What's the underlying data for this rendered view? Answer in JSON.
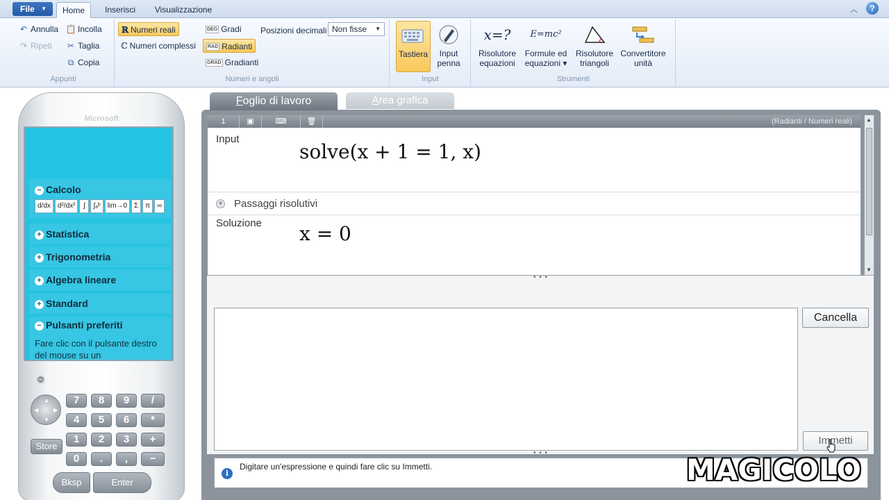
{
  "ribbon": {
    "file_label": "File",
    "tabs": [
      {
        "label": "Home",
        "active": true
      },
      {
        "label": "Inserisci",
        "active": false
      },
      {
        "label": "Visualizzazione",
        "active": false
      }
    ],
    "groups": {
      "appunti": {
        "label": "Appunti",
        "undo": "Annulla",
        "redo": "Ripeti",
        "paste": "Incolla",
        "cut": "Taglia",
        "copy": "Copia"
      },
      "numeri": {
        "label": "Numeri e angoli",
        "real": "Numeri reali",
        "complex": "Numeri complessi",
        "deg_badge": "DEG",
        "deg": "Gradi",
        "rad_badge": "RAD",
        "rad": "Radianti",
        "grad_badge": "GRAD",
        "grad": "Gradianti",
        "decimal_label": "Posizioni decimali",
        "decimal_value": "Non fisse"
      },
      "input": {
        "label": "Input",
        "keyboard_line1": "Tastiera",
        "pen_line1": "Input",
        "pen_line2": "penna"
      },
      "strumenti": {
        "label": "Strumenti",
        "eq_icon": "x=?",
        "eq_line1": "Risolutore",
        "eq_line2": "equazioni",
        "formula_icon": "E=mc²",
        "formula_line1": "Formule ed",
        "formula_line2": "equazioni ▾",
        "tri_line1": "Risolutore",
        "tri_line2": "triangoli",
        "conv_line1": "Convertitore",
        "conv_line2": "unità"
      }
    }
  },
  "calculator": {
    "brand": "Microsoft",
    "sections": {
      "calcolo": "Calcolo",
      "statistica": "Statistica",
      "trigonometria": "Trigonometria",
      "algebra": "Algebra lineare",
      "standard": "Standard",
      "preferiti": "Pulsanti preferiti"
    },
    "favorites_hint": "Fare clic con il pulsante destro del mouse su un",
    "calc_keys": [
      "d/dx",
      "d²/dx²",
      "∫",
      "∫ₐᵇ",
      "lim→0",
      "Σ",
      "π",
      "∞"
    ],
    "keypad": {
      "row1": [
        "7",
        "8",
        "9",
        "/"
      ],
      "row2": [
        "4",
        "5",
        "6",
        "*"
      ],
      "row3": [
        "1",
        "2",
        "3",
        "+"
      ],
      "row4": [
        "0",
        ".",
        ",",
        "−"
      ],
      "store": "Store",
      "bksp": "Bksp",
      "enter": "Enter"
    }
  },
  "worksheet": {
    "tab_main_u": "F",
    "tab_main_rest": "oglio di lavoro",
    "tab_graph_u": "A",
    "tab_graph_rest": "rea grafica",
    "history_index": "1",
    "mode_label": "(Radianti / Numeri reali)",
    "input_label": "Input",
    "input_expr": "solve(x + 1 = 1, x)",
    "steps_label": "Passaggi risolutivi",
    "solution_label": "Soluzione",
    "solution_expr": "x = 0",
    "clear_button": "Cancella",
    "enter_button": "Immetti",
    "input_value": "",
    "status_text": "Digitare un'espressione e quindi fare clic su Immetti."
  },
  "watermark": "MAGICOLO"
}
